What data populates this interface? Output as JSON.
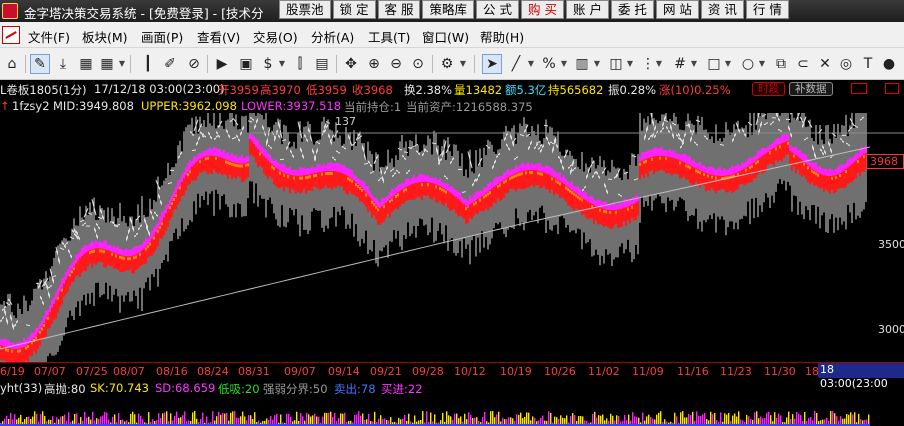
{
  "window": {
    "title": "金字塔决策交易系统 - [免费登录] - [技术分",
    "top_buttons": [
      "股票池",
      "锁 定",
      "客 服",
      "策略库",
      "公 式",
      "购 买",
      "账 户",
      "委 托",
      "网 站",
      "资 讯",
      "行 情"
    ]
  },
  "menu": [
    "文件(F)",
    "板块(M)",
    "画面(P)",
    "查看(V)",
    "交易(O)",
    "分析(A)",
    "工具(T)",
    "窗口(W)",
    "帮助(H)"
  ],
  "toolbar_icons": [
    "home-icon",
    "pencil-icon",
    "download-icon",
    "grid-icon",
    "candlestick-icon",
    "edit-icon",
    "compass-icon",
    "play-icon",
    "dollar-icon",
    "filter-icon",
    "calculator-icon",
    "move-icon",
    "zoom-in-icon",
    "zoom-out-icon",
    "zoom-reset-icon",
    "settings-icon",
    "cursor-icon",
    "line-tool-icon",
    "percent-icon",
    "ruler-icon",
    "gann-icon",
    "hash-icon",
    "rectangle-icon",
    "circle-icon",
    "copy-icon",
    "delete-icon",
    "target-icon",
    "dots-icon"
  ],
  "info": {
    "symbol": "L卷板1805(1分)",
    "datetime": "17/12/18 03:00(23:00)",
    "open": "开3959",
    "high": "高3970",
    "low": "低3959",
    "close": "收3968",
    "turnover": "换2.38%",
    "volume": "量13482",
    "amount": "额5.3亿",
    "open_interest": "持565682",
    "amplitude": "振0.28%",
    "change": "涨(10)0.25%",
    "pill_time": "时段",
    "pill_fill": "补数据"
  },
  "indicator": {
    "name": "1fzsy2",
    "mid": "MID:3949.808",
    "upper": "UPPER:3962.098",
    "lower": "LOWER:3937.518",
    "holding": "当前持仓:1",
    "assets": "当前资产:1216588.375"
  },
  "chart_data": {
    "type": "line",
    "price_labels": [
      "3968",
      "3500",
      "3000"
    ],
    "annotation": "137",
    "date_ticks": [
      "6/19",
      "07/07",
      "07/25",
      "08/07",
      "08/16",
      "08/24",
      "08/31",
      "09/07",
      "09/14",
      "09/21",
      "09/28",
      "10/12",
      "10/19",
      "10/26",
      "11/02",
      "11/09",
      "11/16",
      "11/23",
      "11/30",
      "18"
    ],
    "current_time_tag": "18 03:00(23:00"
  },
  "sub_indicator": {
    "name": "yht(33)",
    "high_throw": "高抛:80",
    "sk": "SK:70.743",
    "sd": "SD:68.659",
    "low_buy": "低吸:20",
    "divide": "强弱分界:50",
    "sell": "卖出:78",
    "buy": "买进:22"
  },
  "colors": {
    "upper_band": "#ff22ff",
    "mid_band": "#ffe600",
    "lower_band": "#ff1a1a",
    "candles": "#e0e0e0",
    "long_ma": "#c8c8c8"
  }
}
